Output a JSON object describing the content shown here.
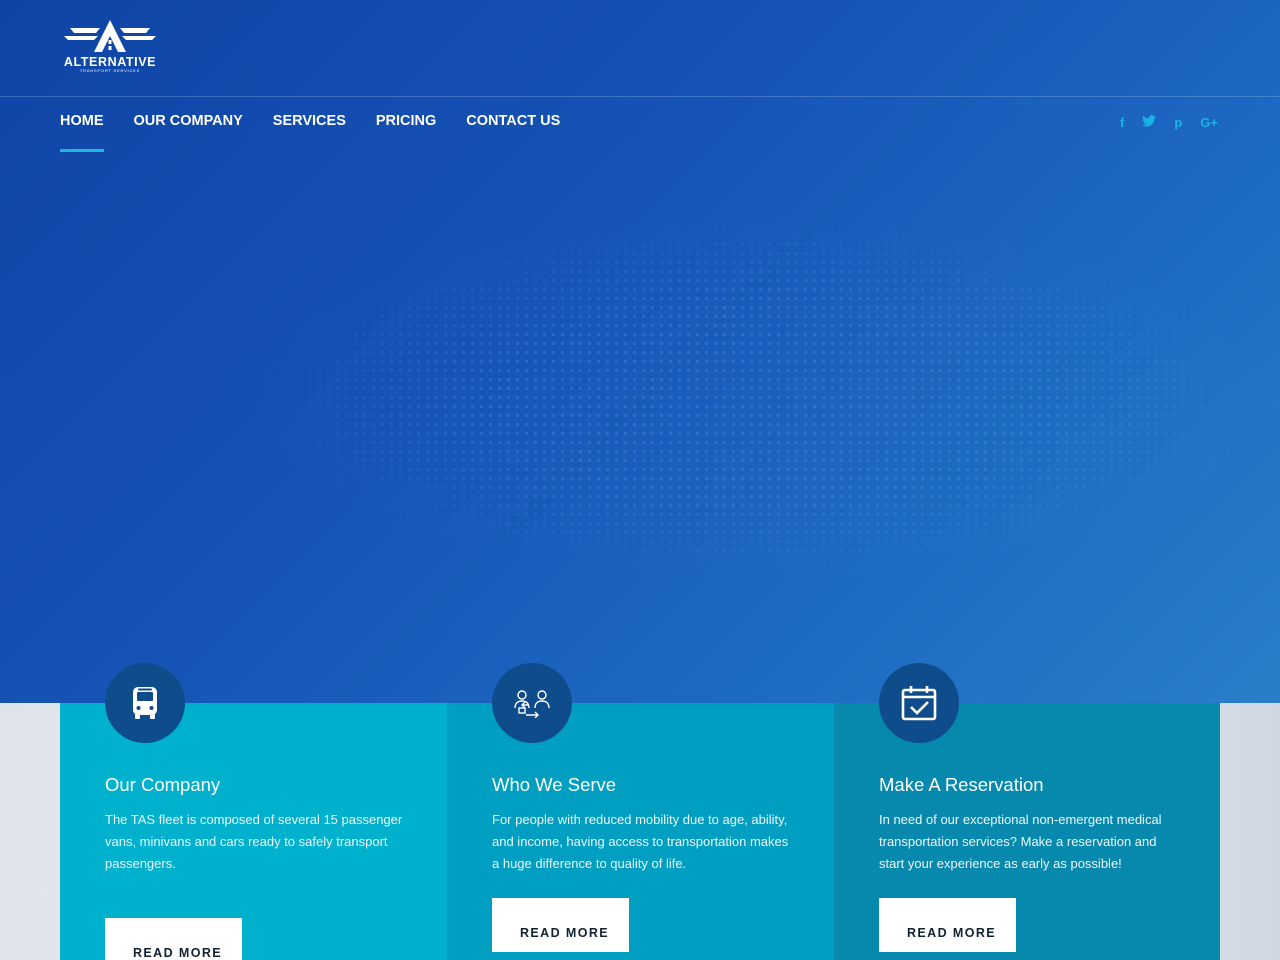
{
  "brand": {
    "name": "ALTERNATIVE",
    "tagline": "TRANSPORT SERVICES"
  },
  "nav": {
    "items": [
      {
        "label": "HOME",
        "active": true
      },
      {
        "label": "OUR COMPANY",
        "active": false
      },
      {
        "label": "SERVICES",
        "active": false
      },
      {
        "label": "PRICING",
        "active": false
      },
      {
        "label": "CONTACT US",
        "active": false
      }
    ]
  },
  "social": {
    "facebook": "f",
    "twitter": "t",
    "pinterest": "p",
    "googleplus": "G+"
  },
  "cards": [
    {
      "icon": "bus-icon",
      "title": "Our Company",
      "text": "The TAS fleet is composed of several 15 passenger vans, minivans and cars ready to safely transport passengers.",
      "button": "READ MORE"
    },
    {
      "icon": "people-transfer-icon",
      "title": "Who We Serve",
      "text": "For people with reduced mobility due to age, ability, and income, having access to transportation makes a huge difference to quality of life.",
      "button": "READ MORE"
    },
    {
      "icon": "calendar-check-icon",
      "title": "Make A Reservation",
      "text": "In need of our exceptional non-emergent medical transportation services? Make a reservation and start your experience as early as possible!",
      "button": "READ MORE"
    }
  ],
  "colors": {
    "hero": "#1553b5",
    "accent": "#1fb6e0",
    "card1": "#00b1cd",
    "card2": "#009fc2",
    "card3": "#0789ae",
    "icon_circle": "#0f4c8c"
  }
}
